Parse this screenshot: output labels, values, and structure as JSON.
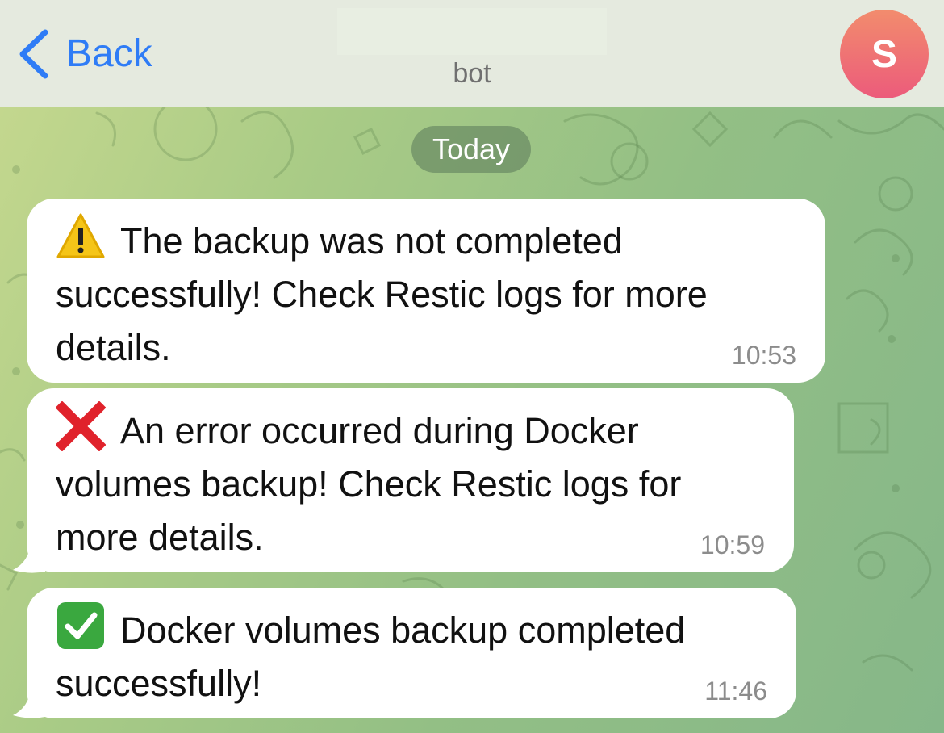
{
  "header": {
    "back_label": "Back",
    "subtitle": "bot",
    "avatar_initial": "S"
  },
  "date_separator": "Today",
  "messages": [
    {
      "icon": "warning-icon",
      "text": "The backup was not completed successfully! Check Restic logs for more details.",
      "time": "10:53"
    },
    {
      "icon": "red-cross-icon",
      "text": "An error occurred during Docker volumes backup! Check Restic logs for more details.",
      "time": "10:59"
    },
    {
      "icon": "check-mark-icon",
      "text": "Docker volumes backup completed successfully!",
      "time": "11:46"
    }
  ],
  "colors": {
    "accent": "#2f7cf6",
    "avatar_top": "#f28c6d",
    "avatar_bottom": "#ec5b7b",
    "bubble": "#ffffff",
    "time_text": "#8c8c8c"
  }
}
